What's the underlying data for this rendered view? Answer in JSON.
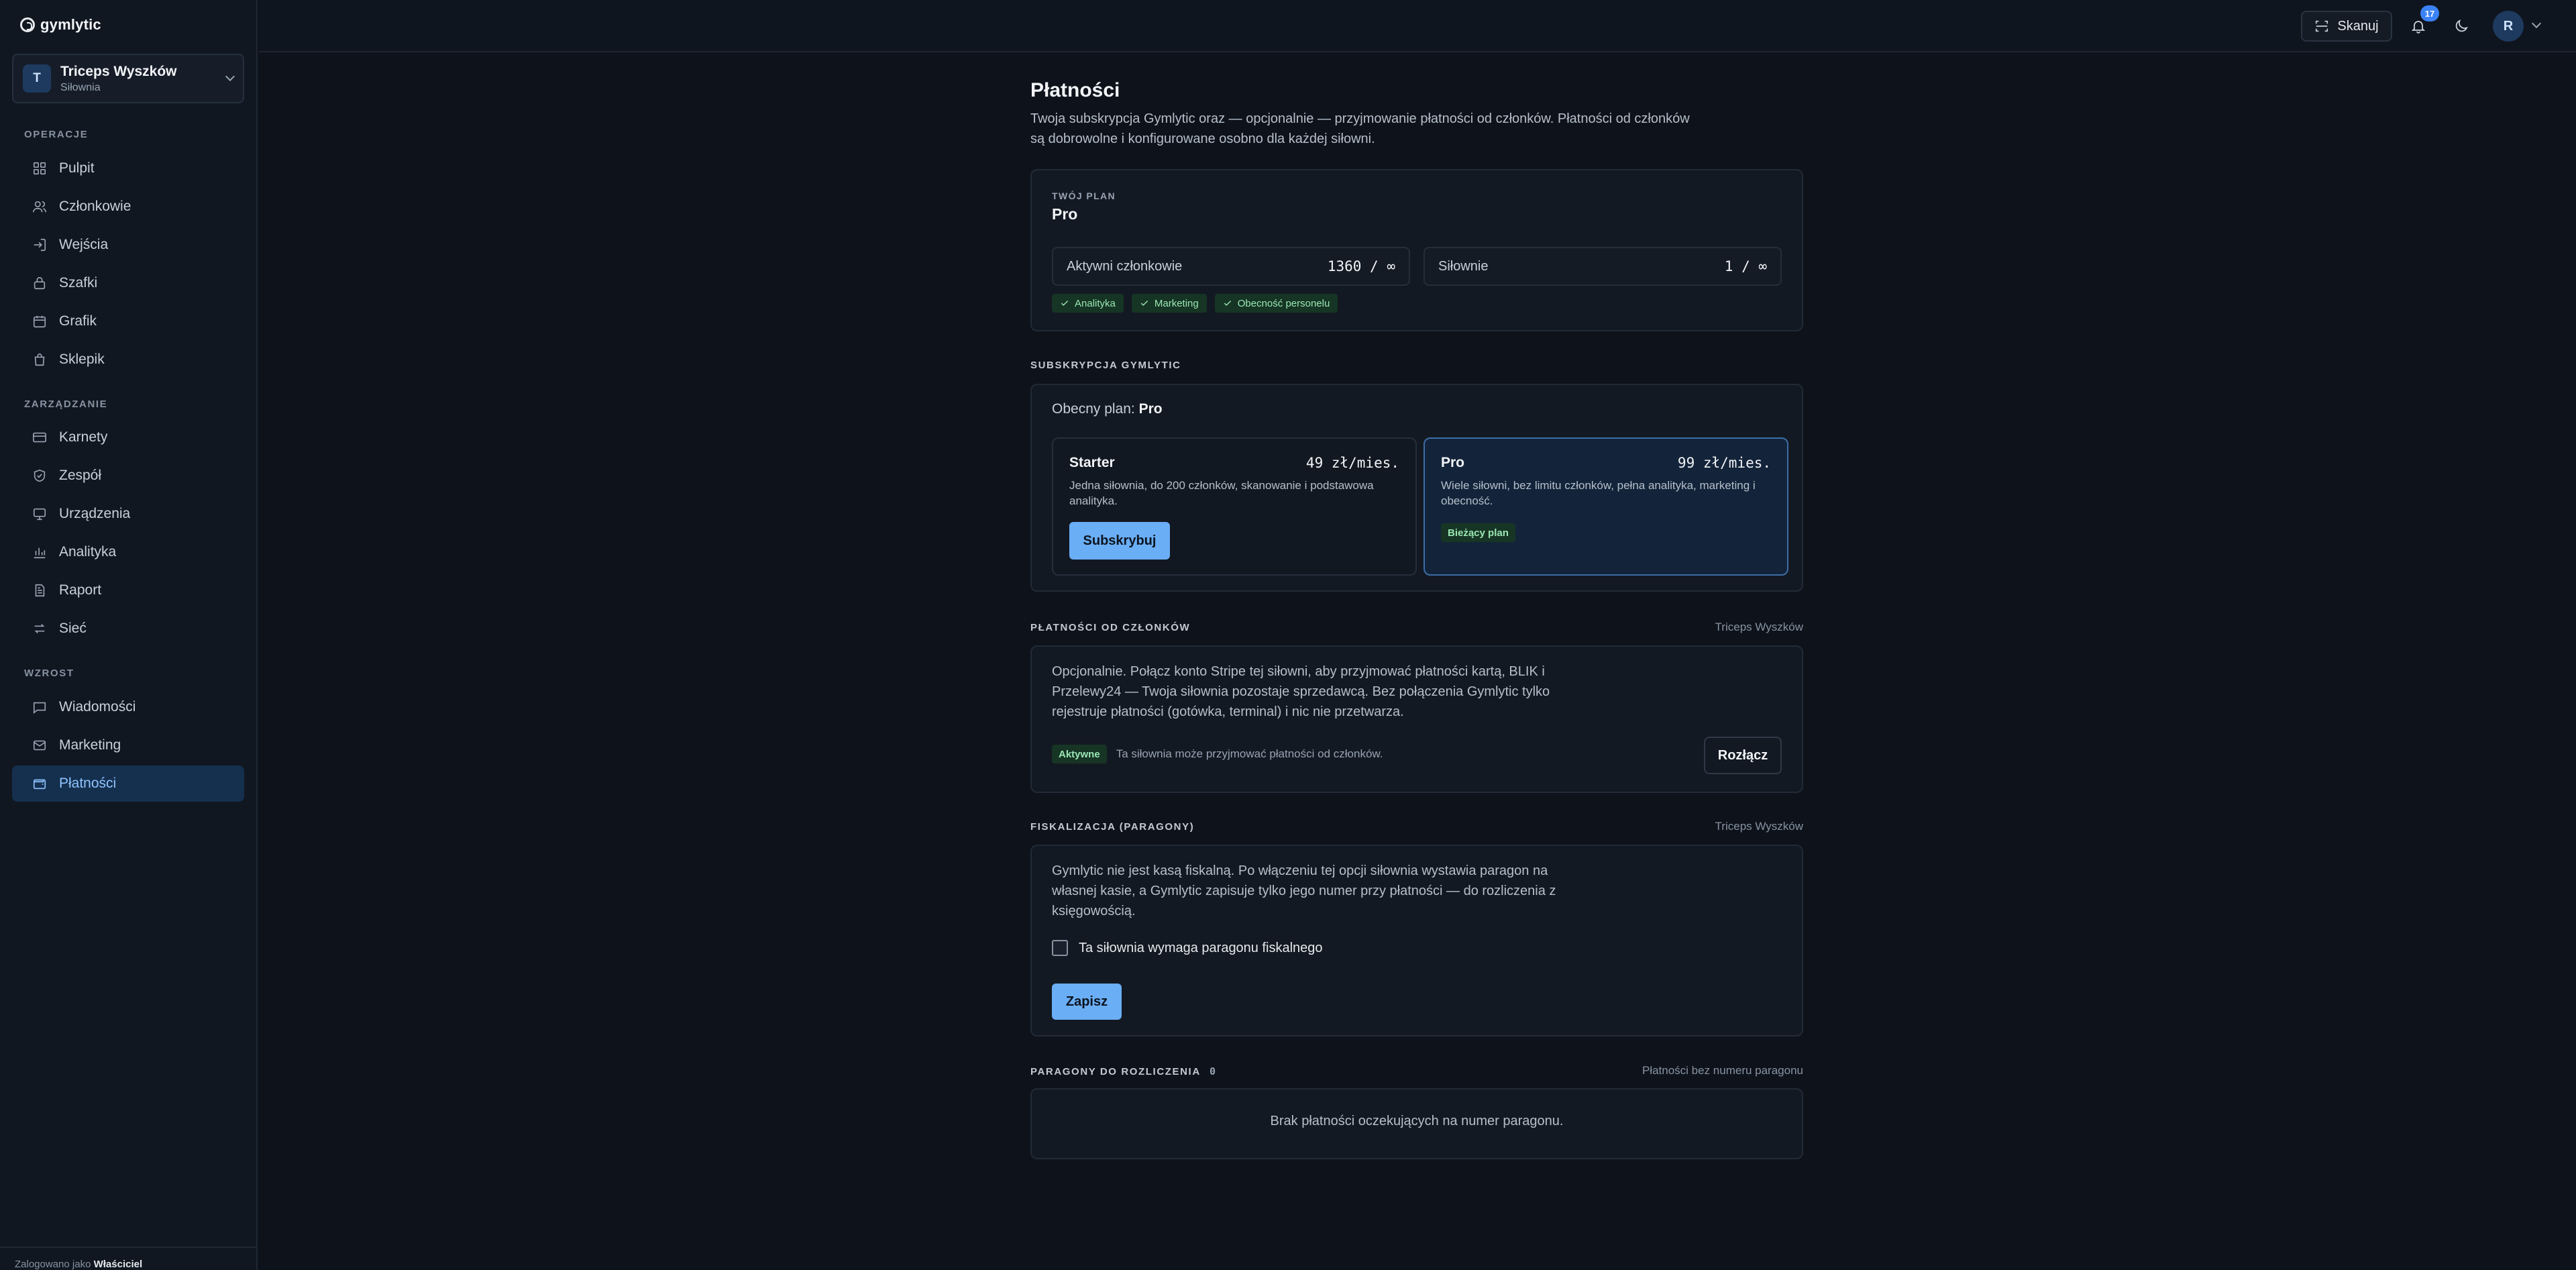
{
  "app": {
    "name": "gymlytic"
  },
  "gym": {
    "initial": "T",
    "name": "Triceps Wyszków",
    "type": "Siłownia"
  },
  "nav": {
    "sections": [
      {
        "title": "OPERACJE",
        "items": [
          "Pulpit",
          "Członkowie",
          "Wejścia",
          "Szafki",
          "Grafik",
          "Sklepik"
        ]
      },
      {
        "title": "ZARZĄDZANIE",
        "items": [
          "Karnety",
          "Zespół",
          "Urządzenia",
          "Analityka",
          "Raport",
          "Sieć"
        ]
      },
      {
        "title": "WZROST",
        "items": [
          "Wiadomości",
          "Marketing",
          "Płatności"
        ]
      }
    ],
    "active": "Płatności"
  },
  "footer": {
    "prefix": "Zalogowano jako",
    "role": "Właściciel"
  },
  "topbar": {
    "scan_label": "Skanuj",
    "notifications_count": "17",
    "user_initial": "R"
  },
  "page": {
    "title": "Płatności",
    "description": "Twoja subskrypcja Gymlytic oraz — opcjonalnie — przyjmowanie płatności od członków. Płatności od członków są dobrowolne i konfigurowane osobno dla każdej siłowni."
  },
  "plan": {
    "label": "TWÓJ PLAN",
    "name": "Pro",
    "stats": [
      {
        "name": "Aktywni członkowie",
        "value": "1360 / ∞"
      },
      {
        "name": "Siłownie",
        "value": "1 / ∞"
      }
    ],
    "features": [
      "Analityka",
      "Marketing",
      "Obecność personelu"
    ]
  },
  "subscription": {
    "label": "SUBSKRYPCJA GYMLYTIC",
    "current_prefix": "Obecny plan:",
    "current": "Pro",
    "tiers": [
      {
        "name": "Starter",
        "price": "49 zł/mies.",
        "description": "Jedna siłownia, do 200 członków, skanowanie i podstawowa analityka.",
        "action": "Subskrybuj"
      },
      {
        "name": "Pro",
        "price": "99 zł/mies.",
        "description": "Wiele siłowni, bez limitu członków, pełna analityka, marketing i obecność.",
        "badge": "Bieżący plan"
      }
    ]
  },
  "member_payments": {
    "label": "PŁATNOŚCI OD CZŁONKÓW",
    "gym": "Triceps Wyszków",
    "description": "Opcjonalnie. Połącz konto Stripe tej siłowni, aby przyjmować płatności kartą, BLIK i Przelewy24 — Twoja siłownia pozostaje sprzedawcą. Bez połączenia Gymlytic tylko rejestruje płatności (gotówka, terminal) i nic nie przetwarza.",
    "status": "Aktywne",
    "status_text": "Ta siłownia może przyjmować płatności od członków.",
    "disconnect": "Rozłącz"
  },
  "fiscal": {
    "label": "FISKALIZACJA (PARAGONY)",
    "gym": "Triceps Wyszków",
    "description": "Gymlytic nie jest kasą fiskalną. Po włączeniu tej opcji siłownia wystawia paragon na własnej kasie, a Gymlytic zapisuje tylko jego numer przy płatności — do rozliczenia z księgowością.",
    "checkbox_label": "Ta siłownia wymaga paragonu fiskalnego",
    "save": "Zapisz"
  },
  "receipts": {
    "label": "PARAGONY DO ROZLICZENIA",
    "count": "0",
    "right": "Płatności bez numeru paragonu",
    "empty": "Brak płatności oczekujących na numer paragonu."
  },
  "colors": {
    "accent": "#6aaef5",
    "success": "#9ae6b4",
    "background": "#0e131b"
  }
}
